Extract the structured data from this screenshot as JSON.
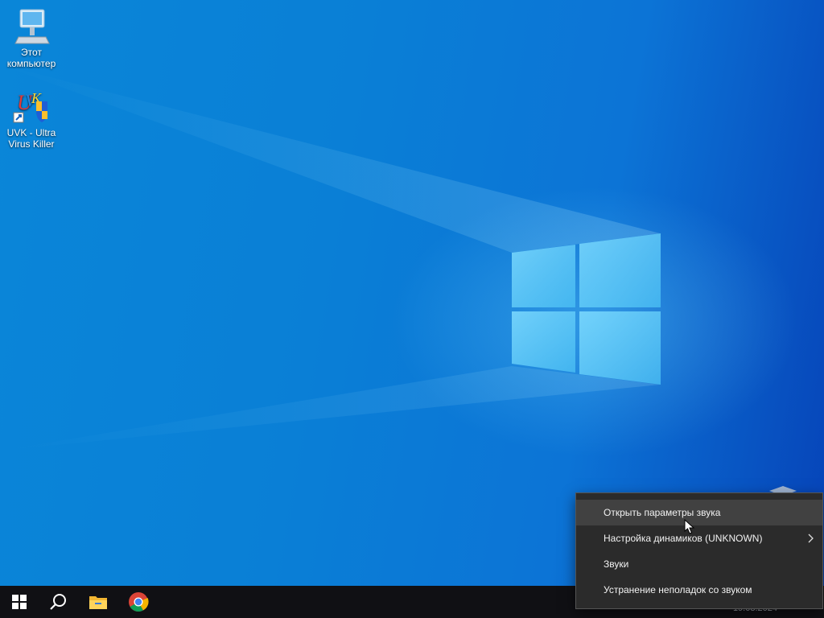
{
  "desktop": {
    "icons": [
      {
        "name": "this-pc-icon",
        "label": "Этот\nкомпьютер"
      },
      {
        "name": "uvk-icon",
        "label": "UVK - Ultra\nVirus Killer"
      }
    ]
  },
  "taskbar": {
    "items": [
      "start-icon",
      "search-icon",
      "file-explorer-icon",
      "chrome-icon"
    ],
    "clock_date": "19.03.2024"
  },
  "context_menu": {
    "items": [
      {
        "label": "Открыть параметры звука",
        "hovered": true,
        "submenu": false
      },
      {
        "label": "Настройка динамиков (UNKNOWN)",
        "hovered": false,
        "submenu": true
      },
      {
        "label": "Звуки",
        "hovered": false,
        "submenu": false
      },
      {
        "label": "Устранение неполадок со звуком",
        "hovered": false,
        "submenu": false
      }
    ]
  },
  "colors": {
    "accent": "#0a7fd6",
    "taskbar": "#101014",
    "menu_bg": "#2b2b2b",
    "menu_hover": "#414141"
  }
}
